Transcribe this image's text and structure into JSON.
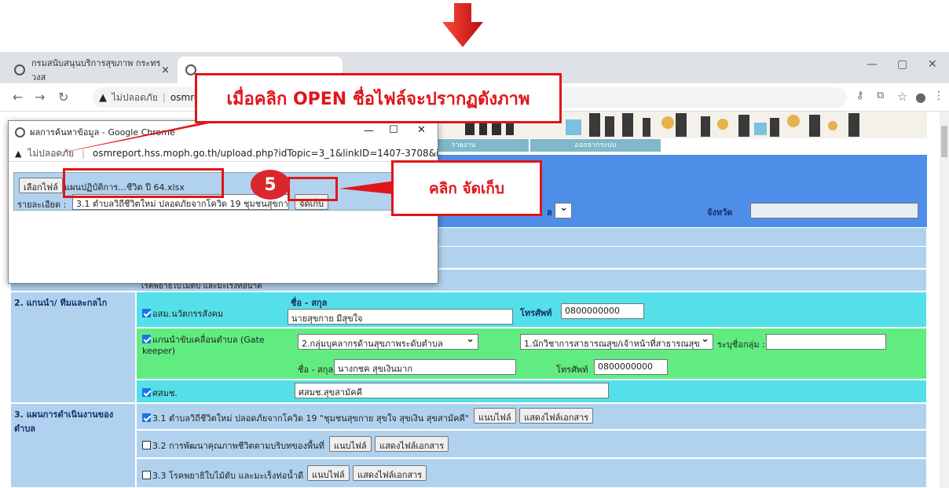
{
  "browser": {
    "tab1_label": "กรมสนับสนุนบริการสุขภาพ กระทรวงส",
    "tab_close": "×",
    "security_label": "ไม่ปลอดภัย",
    "url_partial": "osmrepor",
    "win_min": "—",
    "win_max": "▢",
    "win_close": "✕"
  },
  "menu": {
    "report": "รายงาน",
    "logout": "ออกจากระบบ"
  },
  "popup": {
    "window_title": "ผลการค้นหาข้อมูล - Google Chrome",
    "security_label": "ไม่ปลอดภัย",
    "url": "osmreport.hss.moph.go.th/upload.php?idTopic=3_1&linkID=1407-3708&idN...",
    "choose_file_button": "เลือกไฟล์",
    "selected_file_name": "แผนปฏิบัติการ...ชีวิต ปี 64.xlsx",
    "detail_label": "รายละเอียด :",
    "detail_value": "3.1 ตำบลวิถีชีวิตใหม่ ปลอดภัยจากโควิด 19  ชุมชนสุขกา",
    "save_button": "จัดเก็บ",
    "min": "—",
    "max": "☐",
    "close": "✕"
  },
  "annotations": {
    "top_callout": "เมื่อคลิก OPEN ชื่อไฟล์จะปรากฏดังภาพ",
    "side_callout": "คลิก จัดเก็บ",
    "step_number": "5"
  },
  "form": {
    "province_label": "จังหวัด",
    "district_label_partial": "ล",
    "row_hidden_text": "โรคพยาธิใบไม้ตับ และมะเร็งท่อน้ำดี",
    "section2_label": "2. แกนนำ/ ทีมและกลไก",
    "osm_label": "อสม.นวัตกรรสังคม",
    "name_label": "ชื่อ - สกุล",
    "osm_name_value": "นายสุขกาย มีสุขใจ",
    "phone_label": "โทรศัพท์",
    "osm_phone_value": "0800000000",
    "gatekeeper_label": "แกนนำขับเคลื่อนตำบล (Gate keeper)",
    "gatekeeper_group_select": "2.กลุ่มบุคลากรด้านสุขภาพระดับตำบล",
    "gatekeeper_role_select": "1.นักวิชาการสาธารณสุข/เจ้าหน้าที่สาธารณสุข",
    "specify_group_label": "ระบุชื่อกลุ่ม :",
    "gatekeeper_name_label": "ชื่อ - สกุล",
    "gatekeeper_name_value": "นางกชค สุขเงินมาก",
    "gatekeeper_phone_label": "โทรศัพท์",
    "gatekeeper_phone_value": "0800000000",
    "sasmosh_label": "ศสมช.",
    "sasmosh_value": "ศสมช.สุขสามัคคี",
    "section3_label": "3. แผนการดำเนินงานของตำบล",
    "plan1_label": "3.1 ตำบลวิถีชีวิตใหม่ ปลอดภัยจากโควิด 19 \"ชุมชนสุขกาย สุขใจ สุขเงิน สุขสามัคคี\"",
    "plan2_label": "3.2 การพัฒนาคุณภาพชีวิตตามบริบทของพื้นที่",
    "plan3_label": "3.3 โรคพยาธิใบไม้ตับ และมะเร็งท่อน้ำดี",
    "attach_button": "แนบไฟล์",
    "show_doc_button": "แสดงไฟล์เอกสาร"
  },
  "colors": {
    "accent_red": "#e0151a",
    "header_blue": "#4f8ee8",
    "cyan_row": "#54e0e9",
    "green_row": "#61ec82",
    "light_blue_row": "#b0d2ef"
  }
}
